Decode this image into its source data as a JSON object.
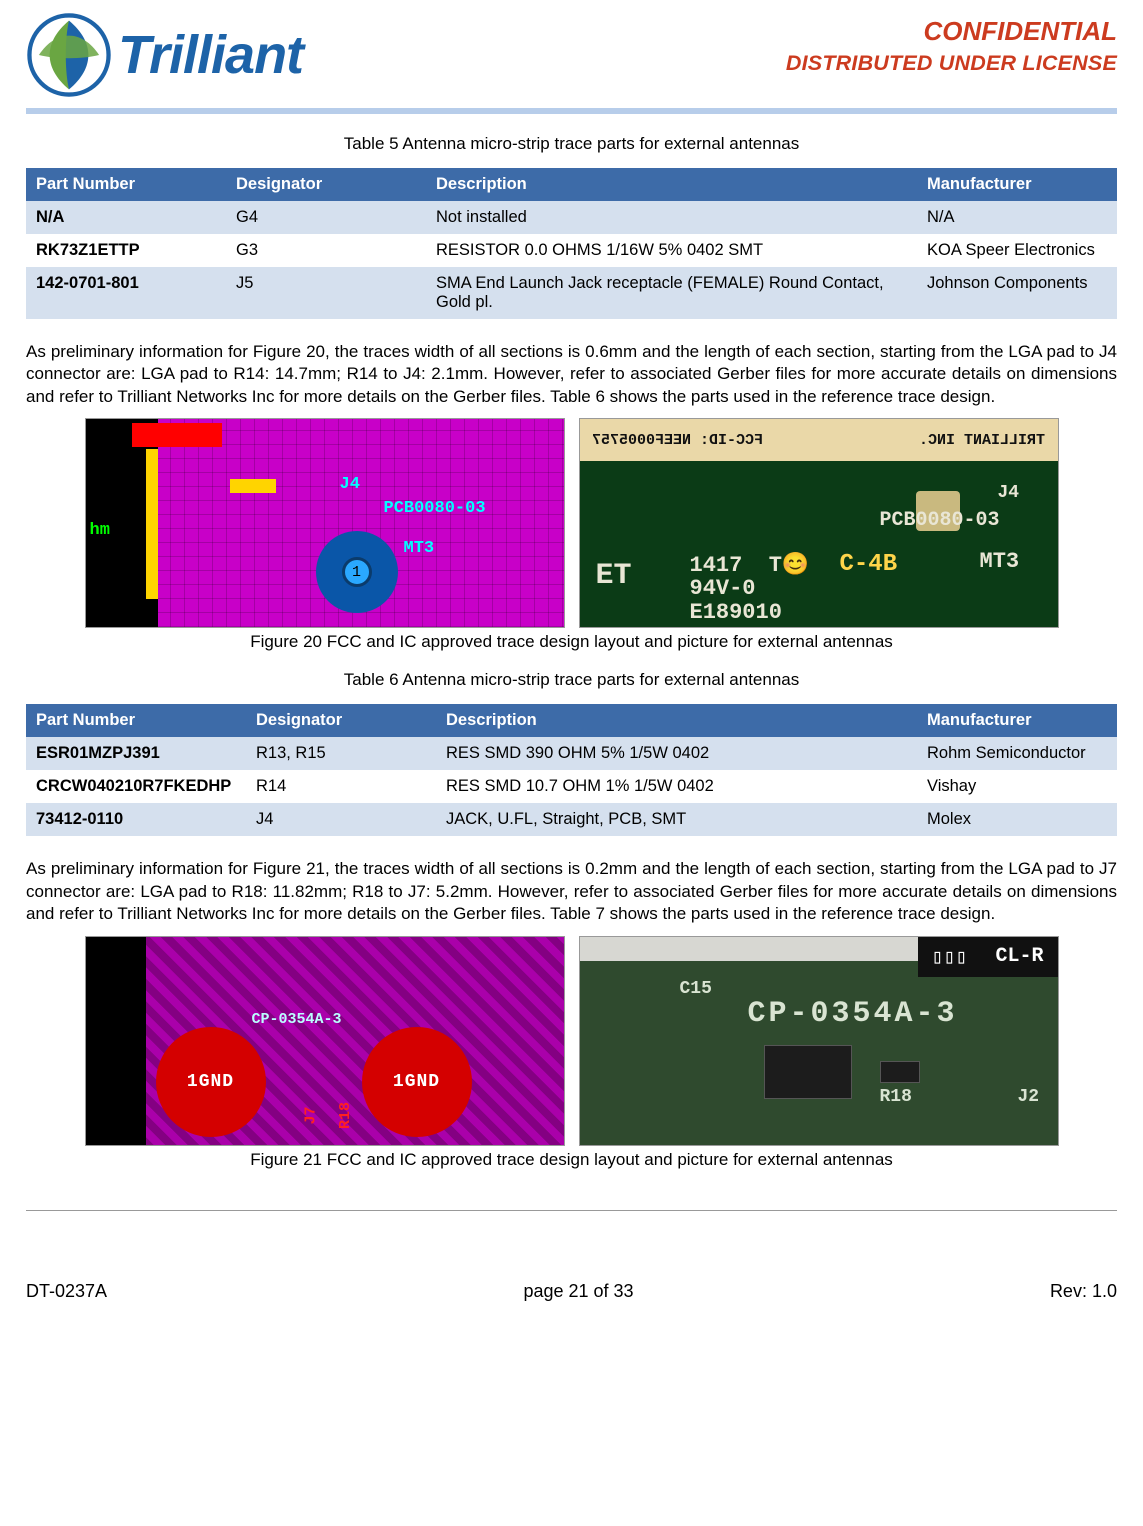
{
  "header": {
    "brand": "Trilliant",
    "confidential": "CONFIDENTIAL",
    "distributed": "DISTRIBUTED UNDER LICENSE"
  },
  "table5": {
    "caption": "Table 5  Antenna micro-strip trace parts for external antennas",
    "cols": [
      "Part Number",
      "Designator",
      "Description",
      "Manufacturer"
    ],
    "rows": [
      {
        "pn": "N/A",
        "des": "G4",
        "desc": "Not installed",
        "mfr": "N/A"
      },
      {
        "pn": "RK73Z1ETTP",
        "des": "G3",
        "desc": "RESISTOR 0.0 OHMS 1/16W 5% 0402 SMT",
        "mfr": "KOA Speer Electronics"
      },
      {
        "pn": "142-0701-801",
        "des": "J5",
        "desc": "SMA End Launch Jack receptacle (FEMALE) Round Contact, Gold pl.",
        "mfr": "Johnson Components"
      }
    ]
  },
  "para1": "As preliminary information for Figure 20, the traces width of all sections is 0.6mm and the length of each section, starting from the LGA pad to J4 connector are: LGA pad to R14: 14.7mm; R14 to J4: 2.1mm.  However, refer to associated Gerber files for more accurate details on dimensions and refer to Trilliant Networks Inc for more details on the Gerber files.  Table 6 shows the parts used in the reference trace design.",
  "fig20": {
    "caption": "Figure 20  FCC and IC approved trace design layout and picture for external antennas",
    "layout_labels": {
      "j4": "J4",
      "pcb": "PCB0080-03",
      "mt3": "MT3",
      "hm": "hm",
      "pad": "1"
    },
    "photo_labels": {
      "top_rev": "TRILLIANT INC.",
      "top_rev2": "FCC-ID: NEEF0005757",
      "j4": "J4",
      "pcb": "PCB0080-03",
      "et": "ET",
      "ul": "94V-0\nE189010",
      "c4b": "C-4B",
      "mt3": "MT3",
      "y1417": "1417",
      "tsym": "T😊"
    }
  },
  "table6": {
    "caption": "Table 6  Antenna micro-strip trace parts for external antennas",
    "cols": [
      "Part Number",
      "Designator",
      "Description",
      "Manufacturer"
    ],
    "rows": [
      {
        "pn": "ESR01MZPJ391",
        "des": "R13, R15",
        "desc": "RES SMD 390 OHM 5% 1/5W 0402",
        "mfr": "Rohm Semiconductor"
      },
      {
        "pn": "CRCW040210R7FKEDHP",
        "des": "R14",
        "desc": "RES SMD 10.7 OHM 1% 1/5W 0402",
        "mfr": "Vishay"
      },
      {
        "pn": "73412-0110",
        "des": "J4",
        "desc": "JACK, U.FL, Straight, PCB, SMT",
        "mfr": "Molex"
      }
    ]
  },
  "para2": "As preliminary information for Figure 21, the traces width of all sections is 0.2mm and the length of each section, starting from the LGA pad to J7 connector are: LGA pad to R18: 11.82mm; R18 to J7: 5.2mm.  However, refer to associated Gerber files for more accurate details on dimensions and refer to Trilliant Networks Inc for more details on the Gerber files.  Table 7 shows the parts used in the reference trace design.",
  "fig21": {
    "caption": "Figure 21  FCC and IC approved trace design layout and picture for external antennas",
    "layout_labels": {
      "gnd": "1GND",
      "cp": "CP-0354A-3",
      "j7": "J7",
      "r18": "R18"
    },
    "photo_labels": {
      "cp": "CP-0354A-3",
      "r18": "R18",
      "j2": "J2",
      "c15": "C15",
      "clr": "CL-R",
      "box": "▯▯▯"
    }
  },
  "footer": {
    "doc": "DT-0237A",
    "page": "page 21 of 33",
    "rev": "Rev: 1.0"
  }
}
